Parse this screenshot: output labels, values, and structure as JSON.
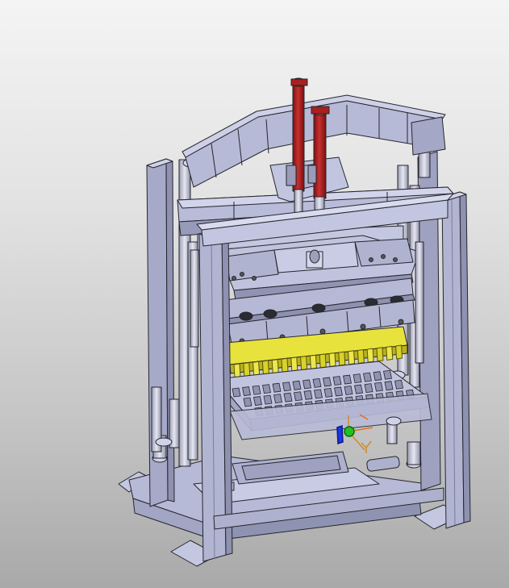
{
  "viewport": {
    "background_top": "#f4f4f4",
    "background_bottom": "#a9a9a9"
  },
  "model": {
    "metal_color": "#b3b6d4",
    "metal_dark": "#8b8fae",
    "metal_light": "#cfd2e8",
    "outline_color": "#25262e",
    "cylinder_color": "#b22222",
    "mold_color": "#e8e23c",
    "icons": [
      "hydraulic-cylinder-icon",
      "brick-mold-icon",
      "tamper-head-icon",
      "frame-column-icon"
    ]
  },
  "triad": {
    "x_color": "#e07020",
    "y_color": "#d08a2a",
    "z_color": "#1e35e0",
    "origin_color": "#22c022"
  }
}
